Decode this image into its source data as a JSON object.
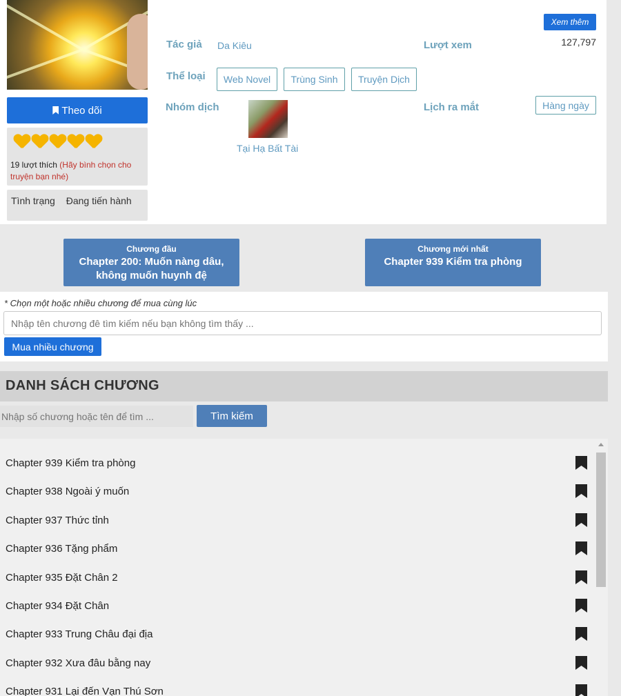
{
  "story": {
    "follow_label": "Theo dõi",
    "likes_text": "19 lượt thích",
    "likes_hint": "(Hãy bình chọn cho truyện bạn nhé)",
    "hearts": 5,
    "status_label": "Tình trạng",
    "status_value": "Đang tiến hành",
    "more_label": "Xem thêm",
    "author_label": "Tác giả",
    "author_value": "Da Kiêu",
    "views_label": "Lượt xem",
    "views_value": "127,797",
    "genre_label": "Thể loại",
    "genres": [
      "Web Novel",
      "Trùng Sinh",
      "Truyện Dịch"
    ],
    "team_label": "Nhóm dịch",
    "team_name": "Tại Hạ Bất Tài",
    "release_label": "Lịch ra mắt",
    "release_value": "Hàng ngày"
  },
  "chapters_nav": {
    "first_label": "Chương đầu",
    "first_title": "Chapter 200: Muốn nàng dâu, không muốn huynh đệ",
    "latest_label": "Chương mới nhất",
    "latest_title": "Chapter 939 Kiểm tra phòng"
  },
  "buy": {
    "hint": "* Chọn một hoặc nhiều chương để mua cùng lúc",
    "placeholder": "Nhập tên chương đê tìm kiếm nếu bạn không tìm thấy ...",
    "button": "Mua nhiều chương"
  },
  "chapter_list": {
    "heading": "DANH SÁCH CHƯƠNG",
    "search_placeholder": "Nhập số chương hoặc tên để tìm ...",
    "search_button": "Tìm kiếm",
    "items": [
      "Chapter 939 Kiểm tra phòng",
      "Chapter 938 Ngoài ý muốn",
      "Chapter 937 Thức tỉnh",
      "Chapter 936 Tặng phẩm",
      "Chapter 935 Đặt Chân 2",
      "Chapter 934 Đặt Chân",
      "Chapter 933 Trung Châu đại địa",
      "Chapter 932 Xưa đâu bằng nay",
      "Chapter 931 Lại đến Vạn Thú Sơn"
    ]
  },
  "colors": {
    "primary": "#1e6fd9",
    "nav_button": "#4f7fb8",
    "label": "#6da2bb",
    "link": "#5f9ac0",
    "heart": "#f5b400"
  }
}
